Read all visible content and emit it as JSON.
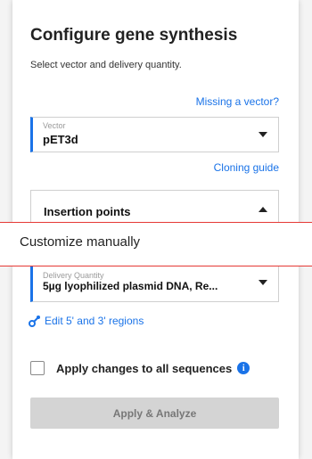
{
  "panel": {
    "title": "Configure gene synthesis",
    "subtitle": "Select vector and delivery quantity.",
    "missing_vector_link": "Missing a vector?",
    "vector": {
      "label": "Vector",
      "value": "pET3d"
    },
    "cloning_guide_link": "Cloning guide",
    "insertion_points": {
      "label": "Insertion points"
    },
    "delivery_quantity": {
      "label": "Delivery Quantity",
      "value": "5µg lyophilized plasmid DNA, Re..."
    },
    "edit_regions_link": "Edit 5' and 3' regions",
    "apply_all_checkbox": {
      "label": "Apply changes to all sequences",
      "checked": false
    },
    "apply_button": "Apply & Analyze"
  },
  "dropdown_overlay": {
    "option": "Customize manually"
  },
  "colors": {
    "accent": "#1a73e8",
    "highlight_border": "#e53935",
    "disabled_button": "#d4d4d4"
  }
}
